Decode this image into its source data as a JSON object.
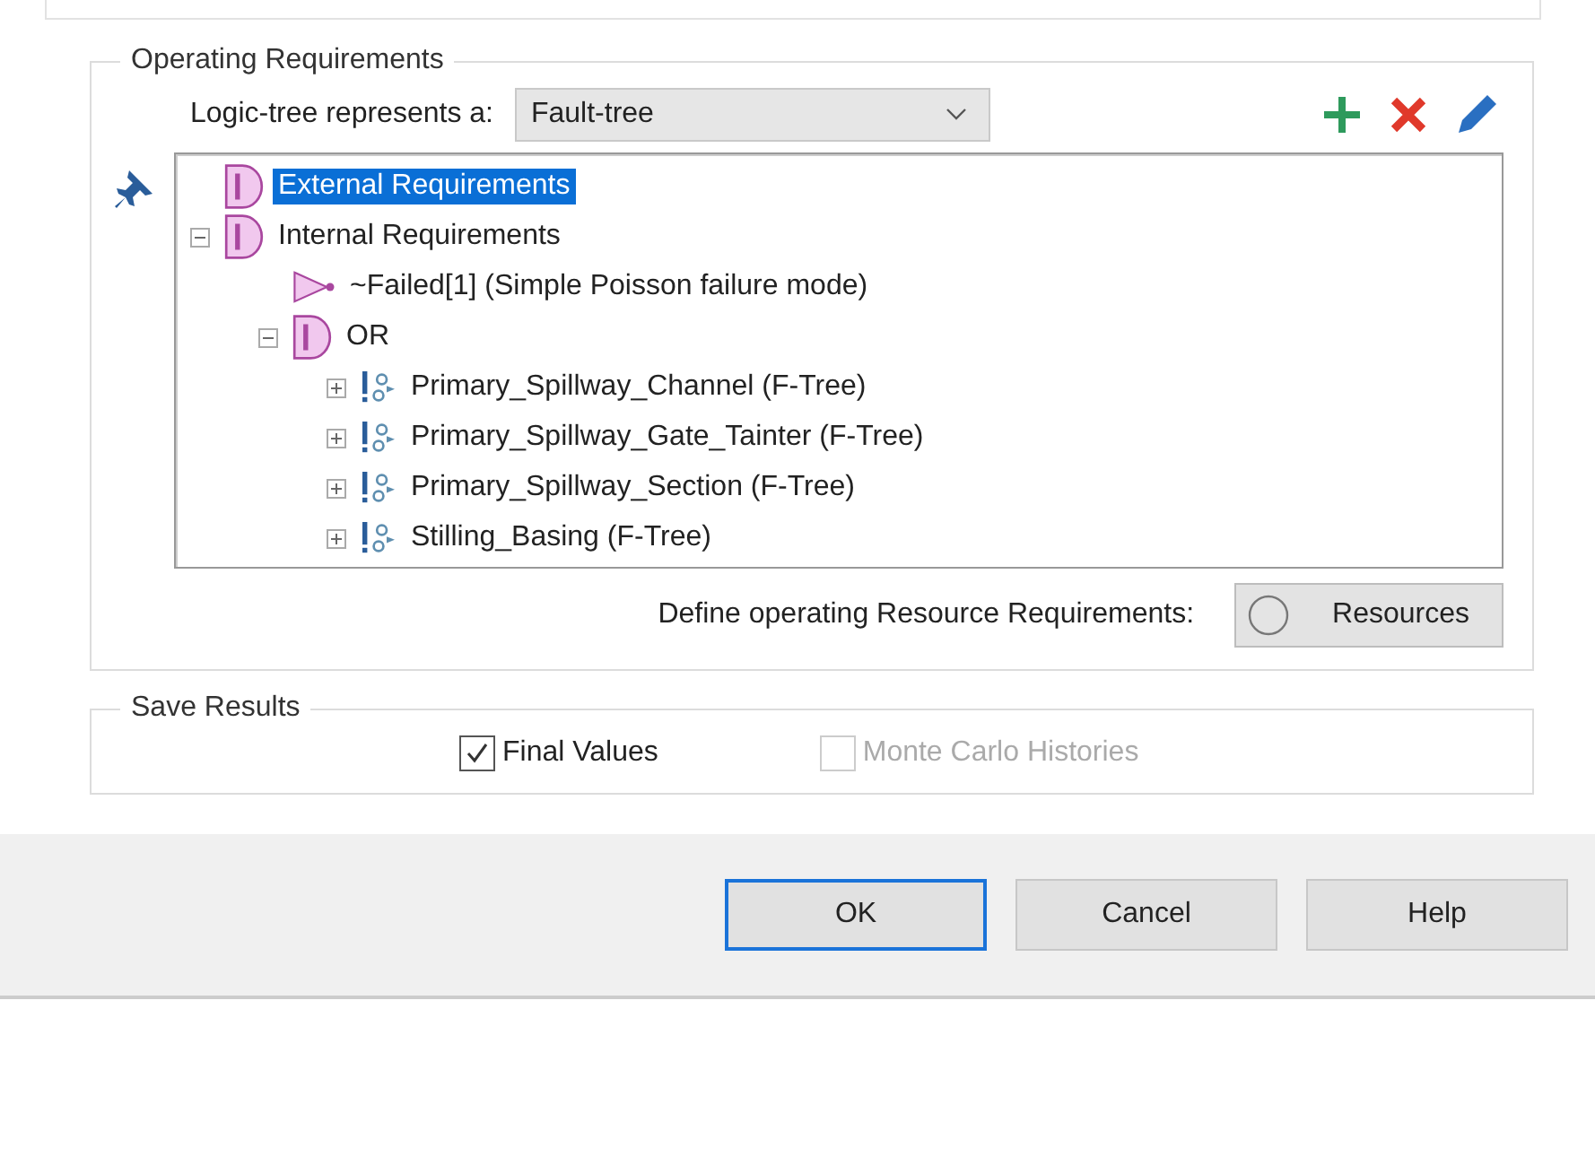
{
  "operating": {
    "title": "Operating Requirements",
    "logic_label": "Logic-tree represents a:",
    "logic_value": "Fault-tree",
    "tree": [
      {
        "label": "External Requirements",
        "kind": "gate",
        "selected": true
      },
      {
        "label": "Internal Requirements",
        "kind": "gate",
        "selected": false,
        "expanded": true,
        "children": [
          {
            "label": "~Failed[1]  (Simple Poisson failure mode)",
            "kind": "event",
            "selected": false
          },
          {
            "label": "OR",
            "kind": "gate",
            "selected": false,
            "expanded": true,
            "children": [
              {
                "label": "Primary_Spillway_Channel (F-Tree)",
                "kind": "subtree",
                "selected": false,
                "expanded": false
              },
              {
                "label": "Primary_Spillway_Gate_Tainter (F-Tree)",
                "kind": "subtree",
                "selected": false,
                "expanded": false
              },
              {
                "label": "Primary_Spillway_Section (F-Tree)",
                "kind": "subtree",
                "selected": false,
                "expanded": false
              },
              {
                "label": "Stilling_Basing (F-Tree)",
                "kind": "subtree",
                "selected": false,
                "expanded": false
              }
            ]
          }
        ]
      }
    ],
    "resource_label": "Define operating Resource Requirements:",
    "resource_button": "Resources"
  },
  "save_results": {
    "title": "Save Results",
    "options": [
      {
        "label": "Final Values",
        "checked": true,
        "disabled": false
      },
      {
        "label": "Monte Carlo Histories",
        "checked": false,
        "disabled": true
      }
    ]
  },
  "buttons": [
    {
      "label": "OK",
      "default": true
    },
    {
      "label": "Cancel",
      "default": false
    },
    {
      "label": "Help",
      "default": false
    }
  ]
}
